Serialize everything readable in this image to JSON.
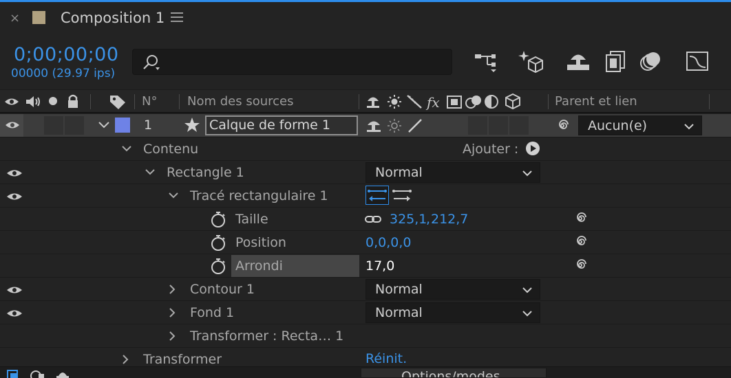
{
  "colors": {
    "accent": "#3b93e8",
    "label": "#6e82e6",
    "panel": "#232323"
  },
  "tab": {
    "close": "×",
    "title": "Composition 1"
  },
  "time": {
    "timecode": "0;00;00;00",
    "frames_fps": "00000 (29.97 ips)"
  },
  "toolbar": {
    "icons": [
      "composition-flowchart-icon",
      "draft-3d-icon",
      "shy-layers-icon",
      "frame-blending-icon",
      "motion-blur-icon",
      "graph-editor-icon"
    ]
  },
  "header": {
    "number": "N°",
    "source_name": "Nom des sources",
    "parent_link": "Parent et lien"
  },
  "layer": {
    "number": "1",
    "name": "Calque de forme 1",
    "parent": "Aucun(e)"
  },
  "tree": {
    "contents": "Contenu",
    "add": "Ajouter :",
    "rectangle": "Rectangle 1",
    "rectangle_mode": "Normal",
    "rect_path": "Tracé rectangulaire 1",
    "size_label": "Taille",
    "size_w": "325,1",
    "size_sep": ",",
    "size_h": "212,7",
    "position_label": "Position",
    "position_value": "0,0,0,0",
    "roundness_label": "Arrondi",
    "roundness_value": "17,0",
    "stroke": "Contour 1",
    "stroke_mode": "Normal",
    "fill": "Fond 1",
    "fill_mode": "Normal",
    "transform_rect": "Transformer : Recta… 1",
    "transform": "Transformer",
    "reset": "Réinit."
  },
  "footer": {
    "options": "Options/modes"
  }
}
